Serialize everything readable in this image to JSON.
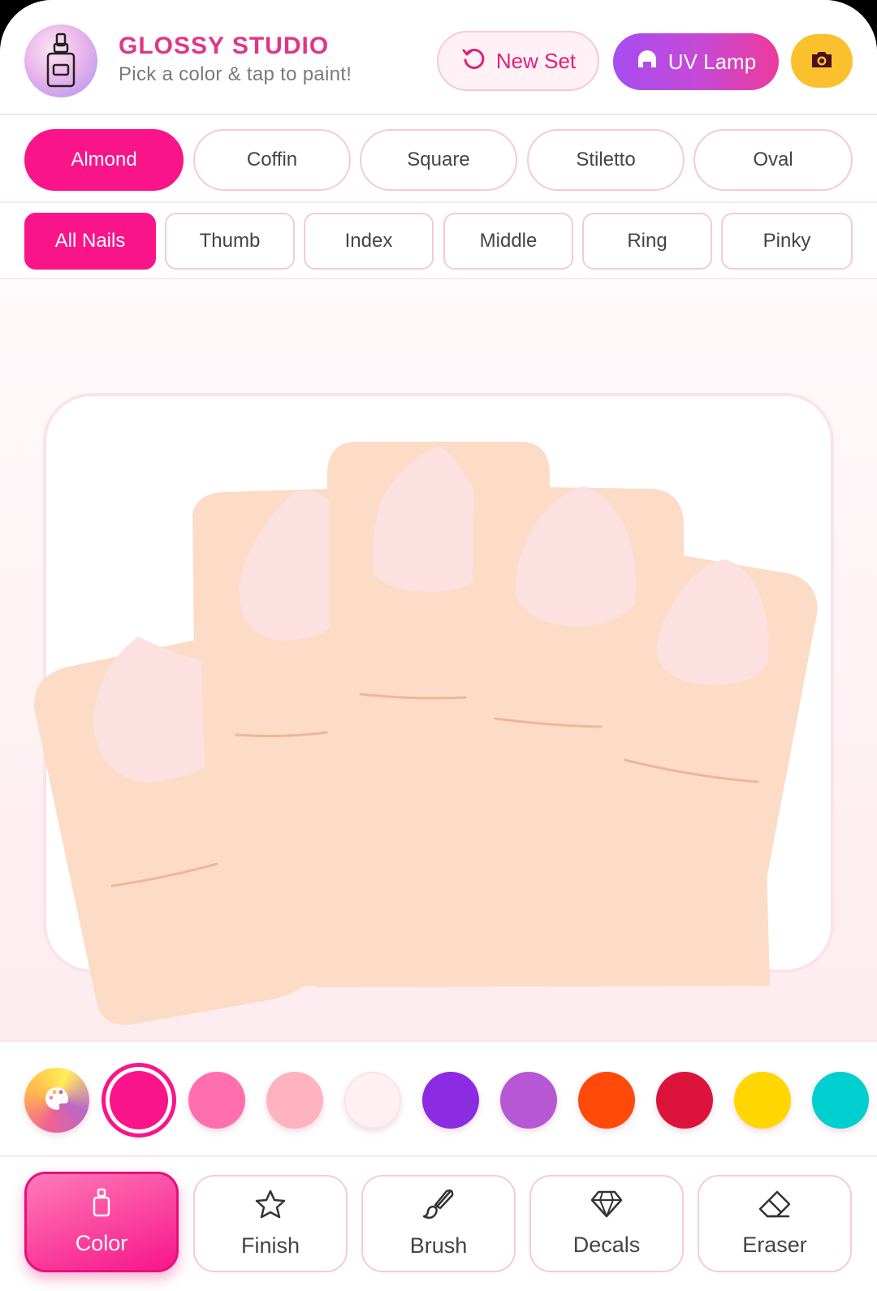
{
  "app": {
    "title": "GLOSSY STUDIO",
    "subtitle": "Pick a color & tap to paint!",
    "logo_icon": "nail-polish-bottle-icon"
  },
  "header": {
    "new_set_label": "New Set",
    "uv_lamp_label": "UV Lamp",
    "camera_icon": "camera-icon"
  },
  "shapes": {
    "selected": "Almond",
    "items": [
      "Almond",
      "Coffin",
      "Square",
      "Stiletto",
      "Oval"
    ]
  },
  "fingers": {
    "selected": "All Nails",
    "items": [
      "All Nails",
      "Thumb",
      "Index",
      "Middle",
      "Ring",
      "Pinky"
    ]
  },
  "palette": {
    "selected": "#f9148a",
    "colors": [
      "#f9148a",
      "#ff6fae",
      "#ffb3c0",
      "#fff0f3",
      "#8b2be2",
      "#b658d4",
      "#ff4a0a",
      "#dc143c",
      "#ffd700",
      "#00cfcf"
    ]
  },
  "tools": {
    "selected": "Color",
    "items": [
      {
        "label": "Color",
        "icon": "polish-bottle-icon"
      },
      {
        "label": "Finish",
        "icon": "star-icon"
      },
      {
        "label": "Brush",
        "icon": "brush-icon"
      },
      {
        "label": "Decals",
        "icon": "diamond-icon"
      },
      {
        "label": "Eraser",
        "icon": "eraser-icon"
      }
    ]
  },
  "colors": {
    "accent": "#f9148a",
    "title": "#e0358a",
    "skin": "#fcdcc6",
    "nail": "#fde0e0",
    "crease": "#eeb69c"
  }
}
